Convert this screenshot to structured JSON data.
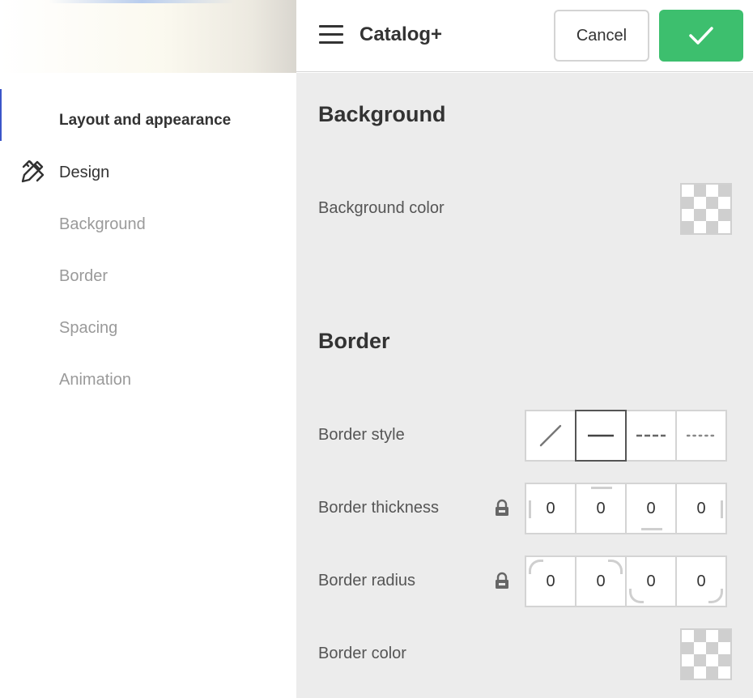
{
  "app": {
    "title": "Catalog+"
  },
  "header": {
    "cancel_label": "Cancel",
    "confirm_icon": "check-icon",
    "menu_icon": "hamburger-menu-icon"
  },
  "sidebar": {
    "items": [
      {
        "label": "Layout and appearance",
        "active": true
      },
      {
        "label": "Design",
        "icon": "pen-ruler-icon"
      },
      {
        "label": "Background"
      },
      {
        "label": "Border"
      },
      {
        "label": "Spacing"
      },
      {
        "label": "Animation"
      }
    ]
  },
  "sections": {
    "background": {
      "title": "Background",
      "color_label": "Background color"
    },
    "border": {
      "title": "Border",
      "style_label": "Border style",
      "style_options": [
        "none",
        "solid",
        "dashed",
        "dotted"
      ],
      "style_selected": "solid",
      "thickness_label": "Border thickness",
      "thickness_values": [
        "0",
        "0",
        "0",
        "0"
      ],
      "radius_label": "Border radius",
      "radius_values": [
        "0",
        "0",
        "0",
        "0"
      ],
      "color_label": "Border color",
      "lock_icon": "lock-icon"
    }
  },
  "colors": {
    "accent": "#3dbf6e",
    "active_indicator": "#3b55c9",
    "panel_bg": "#ececec"
  }
}
